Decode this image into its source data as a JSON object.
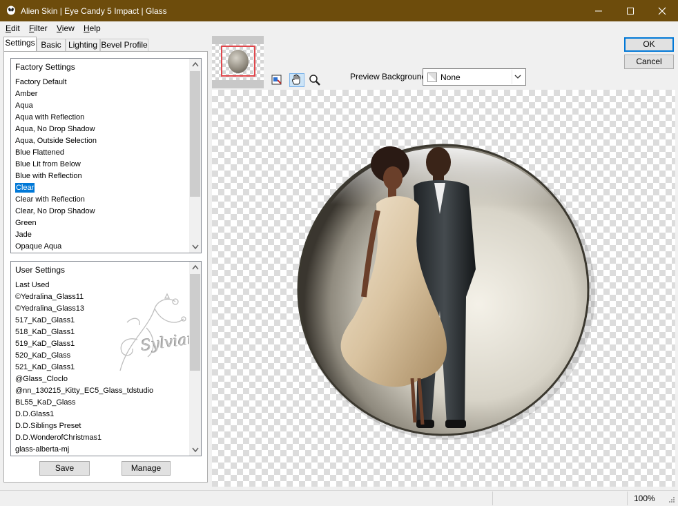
{
  "window": {
    "title": "Alien Skin | Eye Candy 5 Impact | Glass",
    "minimize_glyph": "—",
    "maximize_glyph": "☐",
    "close_glyph": "✕"
  },
  "menu": [
    {
      "label": "Edit",
      "hotkey": "E",
      "rest": "dit"
    },
    {
      "label": "Filter",
      "hotkey": "F",
      "rest": "ilter"
    },
    {
      "label": "View",
      "hotkey": "V",
      "rest": "iew"
    },
    {
      "label": "Help",
      "hotkey": "H",
      "rest": "elp"
    }
  ],
  "tabs": [
    "Settings",
    "Basic",
    "Lighting",
    "Bevel Profile"
  ],
  "factory_settings": {
    "header": "Factory Settings",
    "items": [
      "Factory Default",
      "Amber",
      "Aqua",
      "Aqua with Reflection",
      "Aqua, No Drop Shadow",
      "Aqua, Outside Selection",
      "Blue Flattened",
      "Blue Lit from Below",
      "Blue with Reflection",
      "Clear",
      "Clear with Reflection",
      "Clear, No Drop Shadow",
      "Green",
      "Jade",
      "Opaque Aqua"
    ],
    "selected": "Clear"
  },
  "user_settings": {
    "header": "User Settings",
    "items": [
      "Last Used",
      "©Yedralina_Glass11",
      "©Yedralina_Glass13",
      "517_KaD_Glass1",
      "518_KaD_Glass1",
      "519_KaD_Glass1",
      "520_KaD_Glass",
      "521_KaD_Glass1",
      "@Glass_Cloclo",
      "@nn_130215_Kitty_EC5_Glass_tdstudio",
      "BL55_KaD_Glass",
      "D.D.Glass1",
      "D.D.Siblings Preset",
      "D.D.WonderofChristmas1",
      "glass-alberta-mj"
    ]
  },
  "watermark": "Sylviane",
  "buttons": {
    "save": "Save",
    "manage": "Manage",
    "ok": "OK",
    "cancel": "Cancel"
  },
  "preview_background": {
    "label": "Preview Background:",
    "value": "None"
  },
  "status": {
    "zoom": "100%"
  },
  "icons": {
    "app": "alien-skin-icon",
    "tools": [
      "navigator-icon",
      "hand-tool-icon",
      "zoom-tool-icon"
    ]
  },
  "colors": {
    "titlebar": "#6d4c0c",
    "selection": "#0078d7",
    "nav_frame": "#e0474c"
  }
}
